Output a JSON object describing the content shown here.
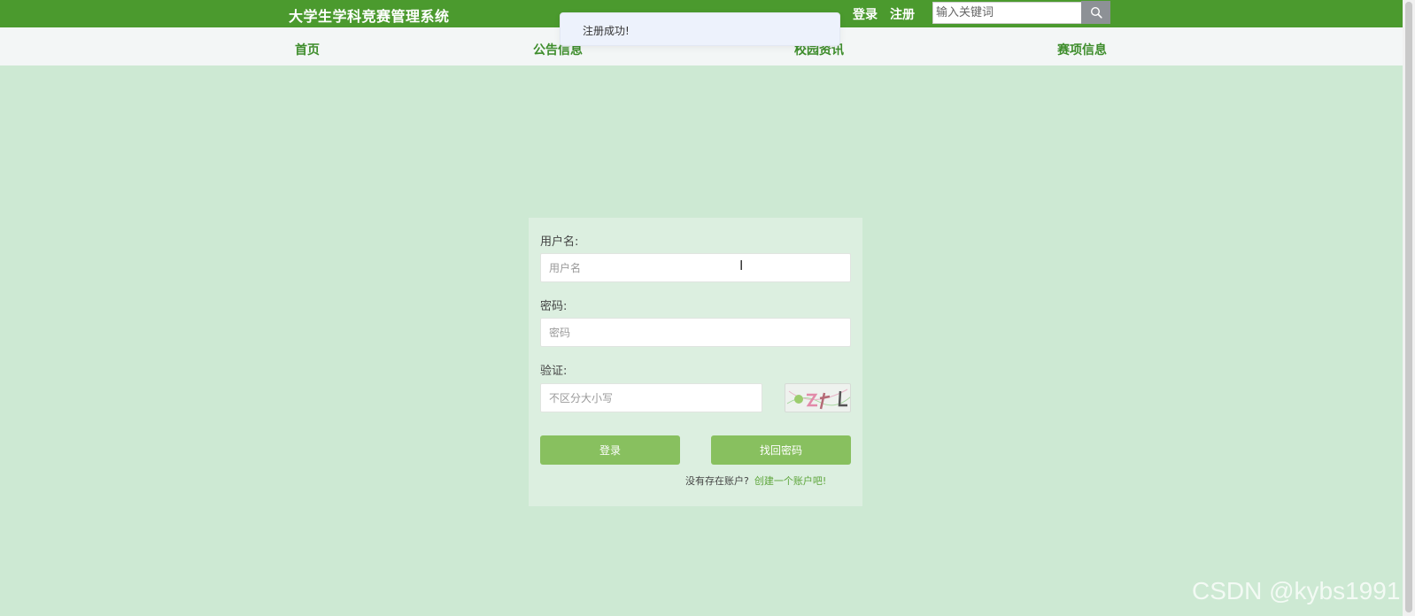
{
  "header": {
    "site_title": "大学生学科竞赛管理系统",
    "login_link": "登录",
    "register_link": "注册",
    "search_placeholder": "输入关键词",
    "search_icon": "search-icon"
  },
  "nav": {
    "items": [
      {
        "label": "首页"
      },
      {
        "label": "公告信息"
      },
      {
        "label": "校园资讯"
      },
      {
        "label": "赛项信息"
      }
    ]
  },
  "toast": {
    "message": "注册成功!"
  },
  "login_form": {
    "username_label": "用户名:",
    "username_placeholder": "用户名",
    "password_label": "密码:",
    "password_placeholder": "密码",
    "captcha_label": "验证:",
    "captcha_placeholder": "不区分大小写",
    "login_button": "登录",
    "recover_button": "找回密码",
    "no_account_text": "没有存在账户?",
    "create_account_link": "创建一个账户吧!"
  },
  "watermark": "CSDN @kybs1991",
  "colors": {
    "topbar": "#4b9a2e",
    "nav_text": "#3e8d2c",
    "page_bg": "#cde9d3",
    "panel_bg": "#dcefe0",
    "button": "#88c05f"
  }
}
